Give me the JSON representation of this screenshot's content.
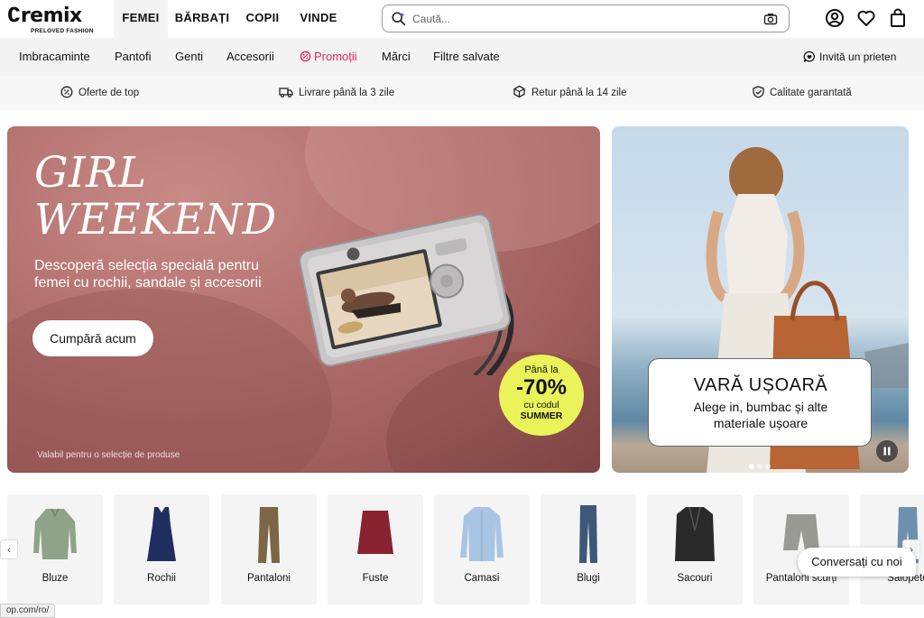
{
  "header": {
    "logo": "remix",
    "logo_sub": "PRELOVED FASHION",
    "tabs": [
      {
        "label": "FEMEI",
        "active": true
      },
      {
        "label": "BĂRBAȚI",
        "active": false
      },
      {
        "label": "COPII",
        "active": false
      },
      {
        "label": "VINDE",
        "active": false
      }
    ],
    "search_placeholder": "Caută...",
    "icons": [
      "account-icon",
      "heart-icon",
      "bag-icon"
    ]
  },
  "nav": {
    "items": [
      "Imbracaminte",
      "Pantofi",
      "Genti",
      "Accesorii",
      "Promoții",
      "Mărci",
      "Filtre salvate"
    ],
    "invite": "Invită un prieten"
  },
  "usp": {
    "items": [
      "Oferte de top",
      "Livrare până la 3 zile",
      "Retur până la 14 zile",
      "Calitate garantată"
    ]
  },
  "hero": {
    "title_line1": "GIRL",
    "title_line2": "WEEKEND",
    "subtitle": "Descoperă selecția specială pentru femei cu rochii, sandale și accesorii",
    "cta": "Cumpără acum",
    "note": "Valabil pentru o selecție de produse",
    "badge": {
      "line1": "Până la",
      "line2": "-70%",
      "line3": "cu codul",
      "line4": "SUMMER"
    },
    "colors": {
      "accent": "#eaf35a",
      "fabric": "#b2706d"
    }
  },
  "side_banner": {
    "title": "VARĂ UȘOARĂ",
    "subtitle": "Alege in, bumbac și alte materiale ușoare"
  },
  "categories": [
    "Bluze",
    "Rochii",
    "Pantaloni",
    "Fuste",
    "Camasi",
    "Blugi",
    "Sacouri",
    "Pantaloni scurți",
    "Salopete"
  ],
  "chat": "Conversați cu noi",
  "status_url": "op.com/ro/"
}
